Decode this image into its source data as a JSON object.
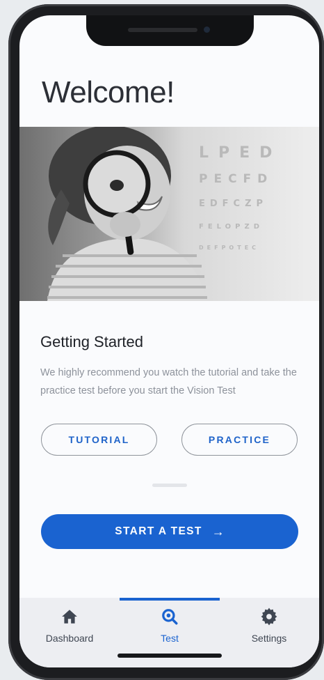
{
  "header": {
    "title": "Welcome!"
  },
  "hero": {
    "eye_chart_rows": [
      "L P E D",
      "P E C F D",
      "E D F C Z P",
      "F E L O P Z D",
      "D E F P O T E C"
    ]
  },
  "getting_started": {
    "title": "Getting Started",
    "body": "We highly recommend you watch the tutorial and take the practice test before you start the Vision Test"
  },
  "actions": {
    "tutorial_label": "TUTORIAL",
    "practice_label": "PRACTICE",
    "start_label": "START A TEST",
    "start_arrow": "→"
  },
  "tabbar": {
    "tabs": [
      {
        "label": "Dashboard",
        "icon": "home-icon"
      },
      {
        "label": "Test",
        "icon": "magnifier-icon",
        "active": true
      },
      {
        "label": "Settings",
        "icon": "gear-icon"
      }
    ]
  },
  "colors": {
    "accent": "#1a63d0",
    "text_dark": "#1e2127",
    "text_muted": "#8d929b"
  }
}
